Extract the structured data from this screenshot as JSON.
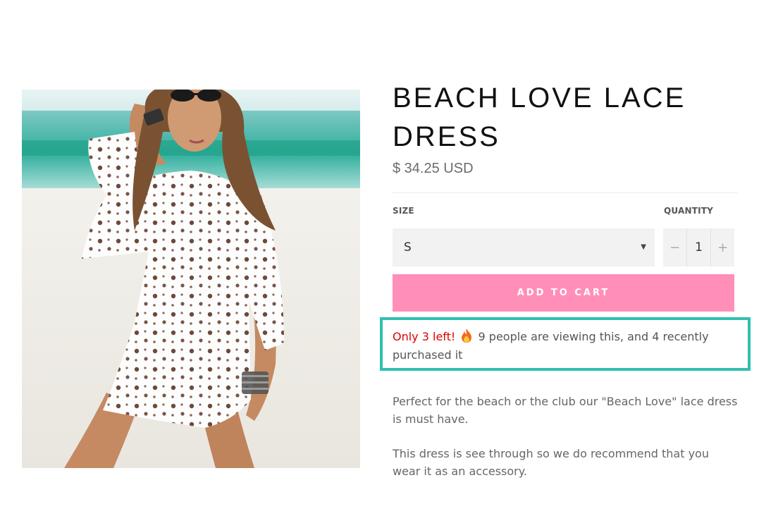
{
  "product": {
    "title": "BEACH LOVE LACE DRESS",
    "price": "$ 34.25 USD",
    "image_alt": "Woman in white lace dress on beach"
  },
  "options": {
    "size_label": "SIZE",
    "size_selected": "S",
    "quantity_label": "QUANTITY",
    "quantity_value": "1",
    "minus_glyph": "−",
    "plus_glyph": "+"
  },
  "cart": {
    "button_label": "ADD TO CART"
  },
  "urgency": {
    "stock_text": "Only 3 left!",
    "viewers_text": "9 people are viewing this, and 4 recently purchased it",
    "icon": "fire-icon",
    "highlight_color": "#2fbfb0"
  },
  "description": {
    "p1": "Perfect for the beach or the club our \"Beach Love\" lace dress is must have.",
    "p2": "This dress is see through so we do recommend that you wear it as an accessory."
  },
  "colors": {
    "accent": "#ff8fb8",
    "alert": "#e00000"
  }
}
